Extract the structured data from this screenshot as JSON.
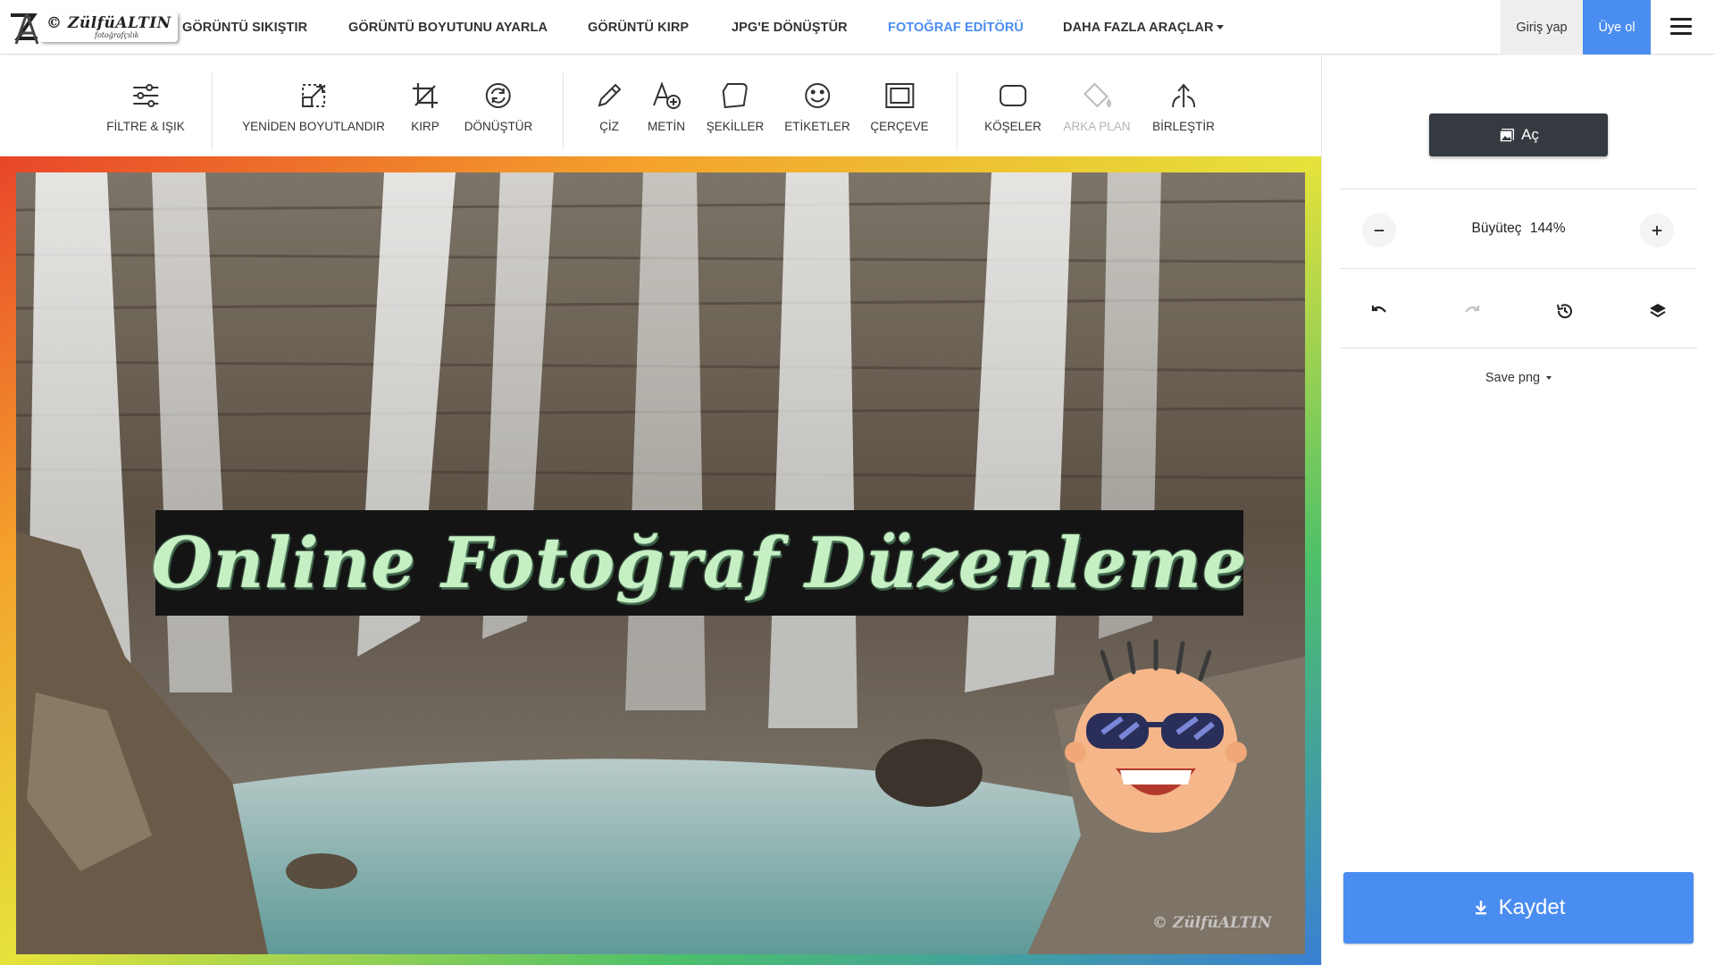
{
  "nav": {
    "logo_text": "© ZülfüALTIN",
    "logo_subtext": "fotoğrafçılık",
    "items": [
      {
        "label": "GÖRÜNTÜ SIKIŞTIR"
      },
      {
        "label": "GÖRÜNTÜ BOYUTUNU AYARLA"
      },
      {
        "label": "GÖRÜNTÜ KIRP"
      },
      {
        "label": "JPG'E DÖNÜŞTÜR"
      },
      {
        "label": "FOTOĞRAF EDİTÖRÜ",
        "active": true
      },
      {
        "label": "DAHA FAZLA ARAÇLAR"
      }
    ],
    "login_label": "Giriş yap",
    "signup_label": "Üye ol",
    "active_color": "#4a8df0"
  },
  "toolbar": {
    "tools": [
      {
        "label": "FİLTRE & IŞIK",
        "icon": "sliders-icon"
      },
      {
        "label": "YENİDEN BOYUTLANDIR",
        "icon": "resize-icon"
      },
      {
        "label": "KIRP",
        "icon": "crop-icon"
      },
      {
        "label": "DÖNÜŞTÜR",
        "icon": "rotate-icon"
      },
      {
        "label": "ÇİZ",
        "icon": "pencil-icon"
      },
      {
        "label": "METİN",
        "icon": "text-add-icon"
      },
      {
        "label": "ŞEKİLLER",
        "icon": "shape-icon"
      },
      {
        "label": "ETİKETLER",
        "icon": "smiley-icon"
      },
      {
        "label": "ÇERÇEVE",
        "icon": "frame-icon"
      },
      {
        "label": "KÖŞELER",
        "icon": "rounded-square-icon"
      },
      {
        "label": "ARKA PLAN",
        "icon": "paint-bucket-icon",
        "disabled": true
      },
      {
        "label": "BİRLEŞTİR",
        "icon": "merge-icon"
      }
    ]
  },
  "canvas": {
    "overlay_title": "Online Fotoğraf Düzenleme",
    "watermark": "© ZülfüALTIN"
  },
  "panel": {
    "open_label": "Aç",
    "zoom_label": "Büyüteç",
    "zoom_value": "144%",
    "save_format": "Save png",
    "save_label": "Kaydet",
    "primary_color": "#4a8df0",
    "dark_color": "#343a40"
  }
}
